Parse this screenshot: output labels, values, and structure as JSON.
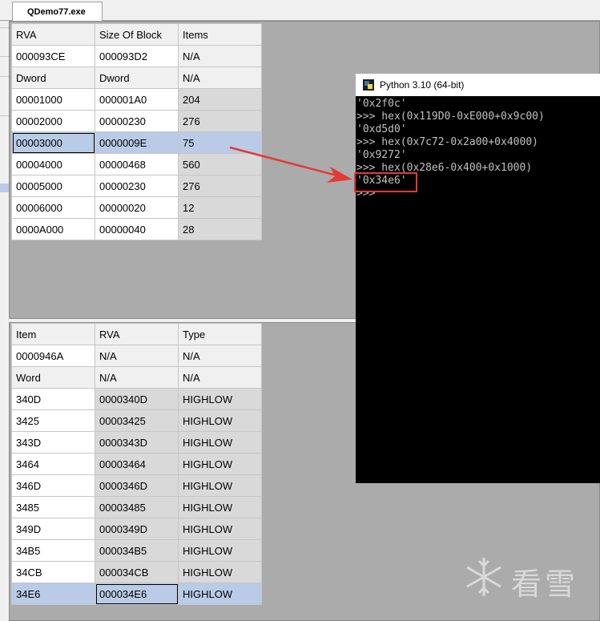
{
  "tab": {
    "title": "QDemo77.exe"
  },
  "top_table": {
    "rows": [
      {
        "cells": [
          "RVA",
          "Size Of Block",
          "Items"
        ],
        "style": "hdr"
      },
      {
        "cells": [
          "000093CE",
          "000093D2",
          "N/A"
        ],
        "style": "wht-wht-hdr"
      },
      {
        "cells": [
          "Dword",
          "Dword",
          "N/A"
        ],
        "style": "hdr"
      },
      {
        "cells": [
          "00001000",
          "000001A0",
          "204"
        ],
        "style": "data"
      },
      {
        "cells": [
          "00002000",
          "00000230",
          "276"
        ],
        "style": "data"
      },
      {
        "cells": [
          "00003000",
          "0000009E",
          "75"
        ],
        "style": "selected"
      },
      {
        "cells": [
          "00004000",
          "00000468",
          "560"
        ],
        "style": "data"
      },
      {
        "cells": [
          "00005000",
          "00000230",
          "276"
        ],
        "style": "data"
      },
      {
        "cells": [
          "00006000",
          "00000020",
          "12"
        ],
        "style": "data"
      },
      {
        "cells": [
          "0000A000",
          "00000040",
          "28"
        ],
        "style": "data"
      }
    ]
  },
  "bottom_table": {
    "rows": [
      {
        "cells": [
          "Item",
          "RVA",
          "Type"
        ],
        "style": "hdr"
      },
      {
        "cells": [
          "0000946A",
          "N/A",
          "N/A"
        ],
        "style": "wht-hdr-hdr"
      },
      {
        "cells": [
          "Word",
          "N/A",
          "N/A"
        ],
        "style": "hdr"
      },
      {
        "cells": [
          "340D",
          "0000340D",
          "HIGHLOW"
        ],
        "style": "data"
      },
      {
        "cells": [
          "3425",
          "00003425",
          "HIGHLOW"
        ],
        "style": "data"
      },
      {
        "cells": [
          "343D",
          "0000343D",
          "HIGHLOW"
        ],
        "style": "data"
      },
      {
        "cells": [
          "3464",
          "00003464",
          "HIGHLOW"
        ],
        "style": "data"
      },
      {
        "cells": [
          "346D",
          "0000346D",
          "HIGHLOW"
        ],
        "style": "data"
      },
      {
        "cells": [
          "3485",
          "00003485",
          "HIGHLOW"
        ],
        "style": "data"
      },
      {
        "cells": [
          "349D",
          "0000349D",
          "HIGHLOW"
        ],
        "style": "data"
      },
      {
        "cells": [
          "34B5",
          "000034B5",
          "HIGHLOW"
        ],
        "style": "data"
      },
      {
        "cells": [
          "34CB",
          "000034CB",
          "HIGHLOW"
        ],
        "style": "data"
      },
      {
        "cells": [
          "34E6",
          "000034E6",
          "HIGHLOW"
        ],
        "style": "selected"
      }
    ]
  },
  "console": {
    "title": "Python 3.10 (64-bit)",
    "lines": [
      "'0x2f0c'",
      ">>> hex(0x119D0-0xE000+0x9c00)",
      "'0xd5d0'",
      ">>> hex(0x7c72-0x2a00+0x4000)",
      "'0x9272'",
      ">>> hex(0x28e6-0x400+0x1000)",
      "'0x34e6'",
      ">>>"
    ]
  },
  "watermark": {
    "text": "看雪"
  },
  "colors": {
    "selection": "#b9cbe6",
    "arrow": "#e53935",
    "console_bg": "#000000",
    "pane_bg": "#ababab"
  }
}
